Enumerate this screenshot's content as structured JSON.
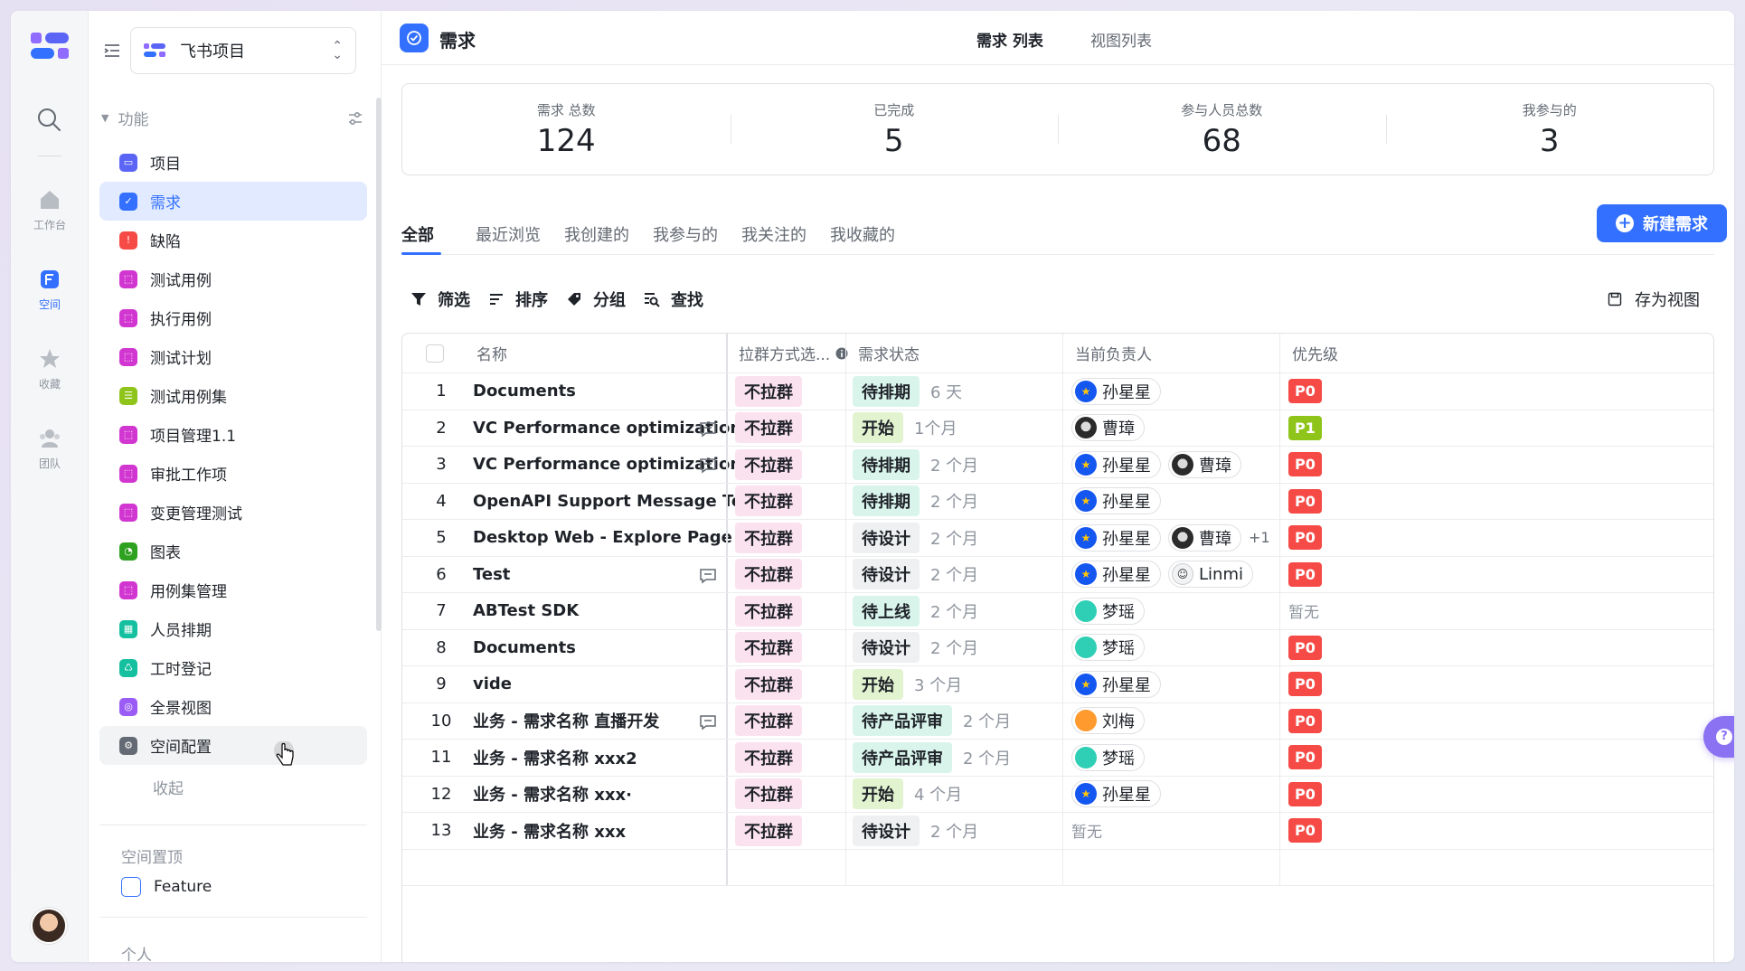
{
  "rail": {
    "items": [
      {
        "label": "工作台"
      },
      {
        "label": "空间"
      },
      {
        "label": "收藏"
      },
      {
        "label": "团队"
      }
    ]
  },
  "sidebar": {
    "project_name": "飞书项目",
    "section_title": "功能",
    "items": [
      {
        "label": "项目",
        "color": "#5b65f5"
      },
      {
        "label": "需求",
        "color": "#3370ff"
      },
      {
        "label": "缺陷",
        "color": "#f54a45"
      },
      {
        "label": "测试用例",
        "color": "#d136d1"
      },
      {
        "label": "执行用例",
        "color": "#d136d1"
      },
      {
        "label": "测试计划",
        "color": "#d136d1"
      },
      {
        "label": "测试用例集",
        "color": "#8fc41b"
      },
      {
        "label": "项目管理1.1",
        "color": "#d136d1"
      },
      {
        "label": "审批工作项",
        "color": "#d136d1"
      },
      {
        "label": "变更管理测试",
        "color": "#d136d1"
      },
      {
        "label": "图表",
        "color": "#2ea121"
      },
      {
        "label": "用例集管理",
        "color": "#d136d1"
      },
      {
        "label": "人员排期",
        "color": "#14c0a0"
      },
      {
        "label": "工时登记",
        "color": "#14c0a0"
      },
      {
        "label": "全景视图",
        "color": "#9a5cf5"
      },
      {
        "label": "空间配置",
        "color": "#646a73"
      }
    ],
    "collapse_label": "收起",
    "pinned_title": "空间置顶",
    "pinned_item": "Feature",
    "personal_title": "个人"
  },
  "header": {
    "title": "需求",
    "tab_list": "需求 列表",
    "tab_views": "视图列表"
  },
  "stats": [
    {
      "label": "需求 总数",
      "value": "124"
    },
    {
      "label": "已完成",
      "value": "5"
    },
    {
      "label": "参与人员总数",
      "value": "68"
    },
    {
      "label": "我参与的",
      "value": "3"
    }
  ],
  "tabs": [
    "全部",
    "最近浏览",
    "我创建的",
    "我参与的",
    "我关注的",
    "我收藏的"
  ],
  "new_button": "新建需求",
  "toolbar": {
    "filter": "筛选",
    "sort": "排序",
    "group": "分组",
    "find": "查找",
    "save_view": "存为视图"
  },
  "table": {
    "headers": {
      "name": "名称",
      "group_mode": "拉群方式选...",
      "status": "需求状态",
      "owner": "当前负责人",
      "priority": "优先级"
    },
    "rows": [
      {
        "index": "1",
        "name": "Documents",
        "comment": false,
        "group": "不拉群",
        "status": "待排期",
        "status_color": "#d9f5eb",
        "duration": "6 天",
        "owners": [
          {
            "name": "孙星星",
            "avatar": "star"
          }
        ],
        "priority": "P0"
      },
      {
        "index": "2",
        "name": "VC Performance optimization ...",
        "comment": true,
        "group": "不拉群",
        "status": "开始",
        "status_color": "#e2f3d0",
        "duration": "1个月",
        "owners": [
          {
            "name": "曹璋",
            "avatar": "photo"
          }
        ],
        "priority": "P1"
      },
      {
        "index": "3",
        "name": "VC Performance optimization ...",
        "comment": true,
        "group": "不拉群",
        "status": "待排期",
        "status_color": "#d9f5eb",
        "duration": "2 个月",
        "owners": [
          {
            "name": "孙星星",
            "avatar": "star"
          },
          {
            "name": "曹璋",
            "avatar": "photo"
          }
        ],
        "priority": "P0"
      },
      {
        "index": "4",
        "name": "OpenAPI Support Message Templ...",
        "comment": false,
        "group": "不拉群",
        "status": "待排期",
        "status_color": "#d9f5eb",
        "duration": "2 个月",
        "owners": [
          {
            "name": "孙星星",
            "avatar": "star"
          }
        ],
        "priority": "P0"
      },
      {
        "index": "5",
        "name": "Desktop Web - Explore Page UI",
        "comment": false,
        "group": "不拉群",
        "status": "待设计",
        "status_color": "#eff0f1",
        "duration": "2 个月",
        "owners": [
          {
            "name": "孙星星",
            "avatar": "star"
          },
          {
            "name": "曹璋",
            "avatar": "photo"
          }
        ],
        "more": "+1",
        "priority": "P0"
      },
      {
        "index": "6",
        "name": "Test",
        "comment": true,
        "group": "不拉群",
        "status": "待设计",
        "status_color": "#eff0f1",
        "duration": "2 个月",
        "owners": [
          {
            "name": "孙星星",
            "avatar": "star"
          },
          {
            "name": "Linmi",
            "avatar": "cartoon"
          }
        ],
        "priority": "P0"
      },
      {
        "index": "7",
        "name": "ABTest SDK",
        "comment": false,
        "group": "不拉群",
        "status": "待上线",
        "status_color": "#d9f5eb",
        "duration": "2 个月",
        "owners": [
          {
            "name": "梦瑶",
            "avatar": "teal"
          }
        ],
        "priority": "暂无"
      },
      {
        "index": "8",
        "name": "Documents",
        "comment": false,
        "group": "不拉群",
        "status": "待设计",
        "status_color": "#eff0f1",
        "duration": "2 个月",
        "owners": [
          {
            "name": "梦瑶",
            "avatar": "teal"
          }
        ],
        "priority": "P0"
      },
      {
        "index": "9",
        "name": "vide",
        "comment": false,
        "group": "不拉群",
        "status": "开始",
        "status_color": "#e2f3d0",
        "duration": "3 个月",
        "owners": [
          {
            "name": "孙星星",
            "avatar": "star"
          }
        ],
        "priority": "P0"
      },
      {
        "index": "10",
        "name": "业务 - 需求名称 直播开发",
        "comment": true,
        "group": "不拉群",
        "status": "待产品评审",
        "status_color": "#d9f5eb",
        "duration": "2 个月",
        "owners": [
          {
            "name": "刘梅",
            "avatar": "orange"
          }
        ],
        "priority": "P0"
      },
      {
        "index": "11",
        "name": "业务 - 需求名称 xxx2",
        "comment": false,
        "group": "不拉群",
        "status": "待产品评审",
        "status_color": "#d9f5eb",
        "duration": "2 个月",
        "owners": [
          {
            "name": "梦瑶",
            "avatar": "teal"
          }
        ],
        "priority": "P0"
      },
      {
        "index": "12",
        "name": "业务 - 需求名称 xxx·",
        "comment": false,
        "group": "不拉群",
        "status": "开始",
        "status_color": "#e2f3d0",
        "duration": "4 个月",
        "owners": [
          {
            "name": "孙星星",
            "avatar": "star"
          }
        ],
        "priority": "P0"
      },
      {
        "index": "13",
        "name": "业务 - 需求名称 xxx",
        "comment": false,
        "group": "不拉群",
        "status": "待设计",
        "status_color": "#eff0f1",
        "duration": "2 个月",
        "owners": [],
        "owner_empty": "暂无",
        "priority": "P0"
      }
    ]
  },
  "help_button": "帮助",
  "colors": {
    "accent": "#3370ff",
    "p0": "#f54a45",
    "p1": "#8fc41b",
    "help": "#8a72f2"
  }
}
